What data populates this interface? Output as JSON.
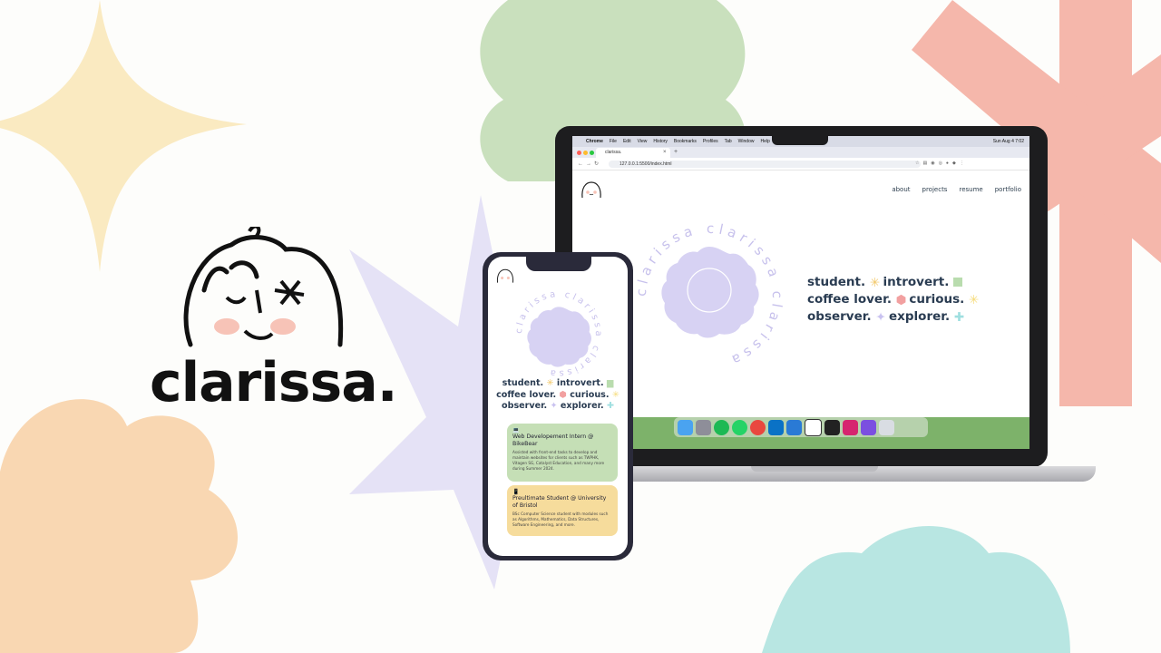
{
  "brand": {
    "name": "clarissa."
  },
  "colors": {
    "star_yellow": "#faeac1",
    "flower_green": "#c9e0bd",
    "x_pink": "#f5b7ab",
    "star_lavender": "#e5e2f6",
    "flower_peach": "#f9d7b2",
    "flower_teal": "#b8e6e2",
    "lavender": "#d7d2f3",
    "text_navy": "#2a3c52"
  },
  "browser": {
    "menubar": {
      "app": "Chrome",
      "menus": [
        "File",
        "Edit",
        "View",
        "History",
        "Bookmarks",
        "Profiles",
        "Tab",
        "Window",
        "Help"
      ],
      "clock": "Sun Aug 4  7:02"
    },
    "tab_title": "clarissa.",
    "url": "127.0.0.1:5500/index.html"
  },
  "site": {
    "nav": [
      "about",
      "projects",
      "resume",
      "portfolio"
    ],
    "circle_text": "clarissa",
    "tagline": {
      "line1": [
        "student.",
        "introvert."
      ],
      "line2": [
        "coffee lover.",
        "curious."
      ],
      "line3": [
        "observer.",
        "explorer."
      ]
    }
  },
  "dock": {
    "apps": [
      "finder-icon",
      "launchpad-icon",
      "spotify-icon",
      "whatsapp-icon",
      "chrome-icon",
      "outlook-icon",
      "vscode-icon",
      "notion-icon",
      "app-icon",
      "intellij-icon",
      "canva-icon",
      "trash-icon"
    ]
  },
  "phone": {
    "cards": [
      {
        "emoji": "💻",
        "title": "Web Developement Intern @ BikeBear",
        "desc": "Assisted with front-end tasks to develop and maintain websites for clients such as TWPHK, Vitagen SG, Catalyst Education, and many more during Summer 2024.",
        "color": "#c5dfb6"
      },
      {
        "emoji": "📱",
        "title": "Preultimate Student @ University of Bristol",
        "desc": "BSc Computer Science student with modules such as Algorithms, Mathematics, Data Structures, Software Engineering, and more.",
        "color": "#f6dc9c"
      }
    ]
  }
}
